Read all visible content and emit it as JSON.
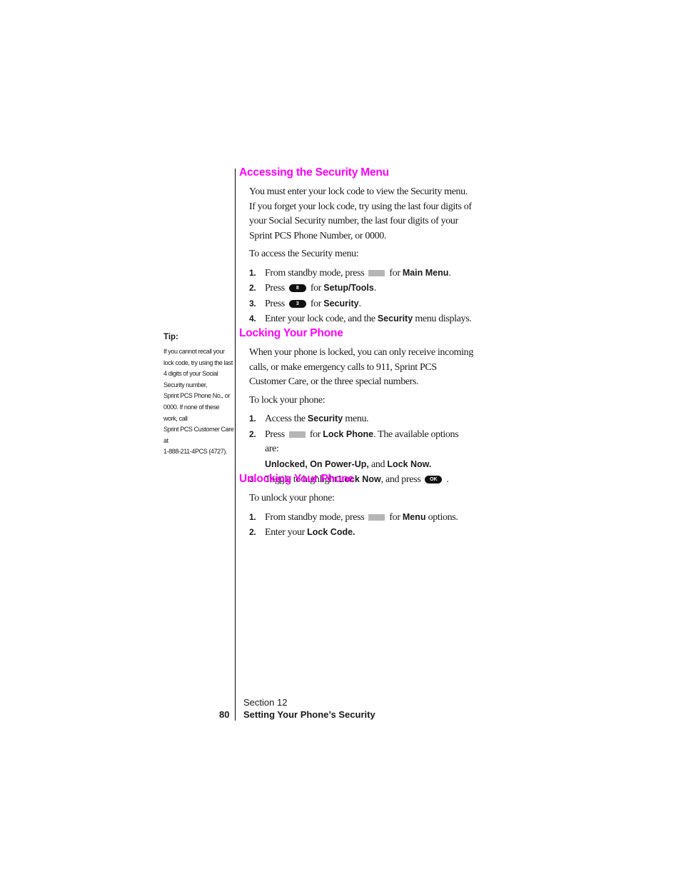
{
  "sections": [
    {
      "heading": "Accessing the Security Menu",
      "intro": "You must enter your lock code to view the Security menu. If you forget your lock code, try using the last four digits of your Social Security number, the last four digits of your Sprint PCS Phone Number, or 0000.",
      "lead": "To access the Security menu:",
      "steps": [
        {
          "num": "1.",
          "pre": "From standby mode, press",
          "key": "softkey",
          "mid": "for",
          "bold": "Main Menu",
          "post": "."
        },
        {
          "num": "2.",
          "pre": "Press",
          "key": "8",
          "mid": "for",
          "bold": "Setup/Tools",
          "post": "."
        },
        {
          "num": "3.",
          "pre": "Press",
          "key": "3",
          "mid": "for",
          "bold": "Security",
          "post": "."
        },
        {
          "num": "4.",
          "pre": "Enter your lock code, and the",
          "bold": "Security",
          "post": "menu displays."
        }
      ]
    },
    {
      "heading": "Locking Your Phone",
      "intro": "When your phone is locked, you can only receive incoming calls, or make emergency calls to 911, Sprint PCS Customer Care, or the three special numbers.",
      "lead": "To lock your phone:",
      "steps": [
        {
          "num": "1.",
          "pre": "Access the",
          "bold": "Security",
          "post": "menu."
        },
        {
          "num": "2.",
          "pre": "Press",
          "key": "softkey",
          "mid": "for",
          "bold": "Lock Phone",
          "post": ". The available options are:",
          "bold2": "Unlocked, On Power-Up,",
          "mid2": "and",
          "bold3": "Lock Now."
        },
        {
          "num": "3.",
          "pre": "Toggle to highlight",
          "bold": "Lock Now",
          "post": ", and press",
          "key": "OK",
          "end": "."
        }
      ]
    },
    {
      "heading": "Unlocking Your Phone",
      "lead": "To unlock your phone:",
      "steps": [
        {
          "num": "1.",
          "pre": "From standby mode, press",
          "key": "softkey",
          "mid": "for",
          "bold": "Menu",
          "post": "options."
        },
        {
          "num": "2.",
          "pre": "Enter your",
          "bold": "Lock Code."
        }
      ]
    }
  ],
  "tip": {
    "title": "Tip:",
    "lines": [
      "If you cannot recall your",
      "lock code, try using the last",
      "4 digits of your Social",
      "Security number,",
      "Sprint PCS Phone No., or",
      "0000. If none of these",
      "work, call",
      "Sprint PCS Customer Care",
      "at",
      "1-888-211-4PCS (4727)."
    ]
  },
  "footer": {
    "section_label": "Section 12",
    "page_number": "80",
    "page_title": "Setting Your Phone’s Security"
  },
  "colors": {
    "heading": "#ff00ff",
    "softkey": "#b5b5b5"
  }
}
